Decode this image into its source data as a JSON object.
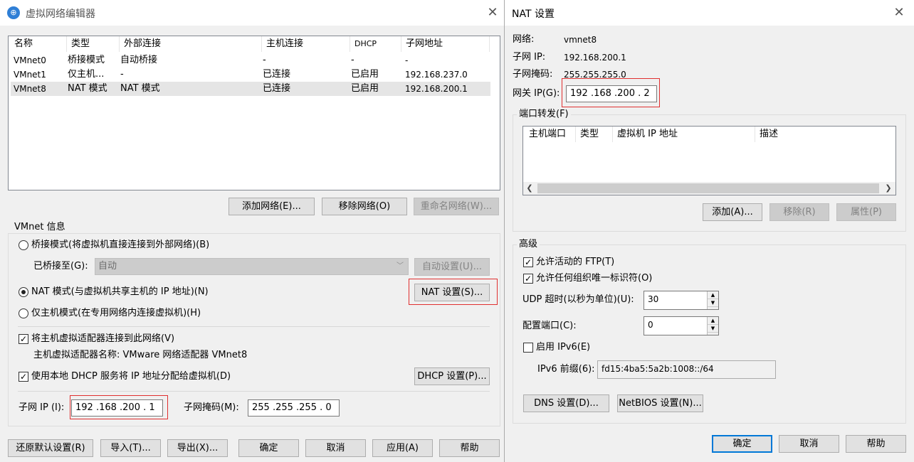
{
  "left": {
    "title": "虚拟网络编辑器",
    "table": {
      "headers": [
        "名称",
        "类型",
        "外部连接",
        "主机连接",
        "DHCP",
        "子网地址"
      ],
      "rows": [
        [
          "VMnet0",
          "桥接模式",
          "自动桥接",
          "-",
          "-",
          "-"
        ],
        [
          "VMnet1",
          "仅主机...",
          "-",
          "已连接",
          "已启用",
          "192.168.237.0"
        ],
        [
          "VMnet8",
          "NAT 模式",
          "NAT 模式",
          "已连接",
          "已启用",
          "192.168.200.1"
        ]
      ]
    },
    "add_network": "添加网络(E)...",
    "remove_network": "移除网络(O)",
    "rename_network": "重命名网络(W)...",
    "vmnet_info": "VMnet 信息",
    "bridged_mode": "桥接模式(将虚拟机直接连接到外部网络)(B)",
    "bridged_to_label": "已桥接至(G):",
    "bridged_to_value": "自动",
    "auto_settings": "自动设置(U)...",
    "nat_mode": "NAT 模式(与虚拟机共享主机的 IP 地址)(N)",
    "nat_settings": "NAT 设置(S)...",
    "host_only_mode": "仅主机模式(在专用网络内连接虚拟机)(H)",
    "connect_adapter": "将主机虚拟适配器连接到此网络(V)",
    "adapter_name": "主机虚拟适配器名称: VMware 网络适配器 VMnet8",
    "use_dhcp": "使用本地 DHCP 服务将 IP 地址分配给虚拟机(D)",
    "dhcp_settings": "DHCP 设置(P)...",
    "subnet_ip_label": "子网 IP (I):",
    "subnet_ip": "192 .168 .200 . 1",
    "subnet_mask_label": "子网掩码(M):",
    "subnet_mask": "255 .255 .255 . 0",
    "restore_defaults": "还原默认设置(R)",
    "import": "导入(T)...",
    "export": "导出(X)...",
    "ok": "确定",
    "cancel": "取消",
    "apply": "应用(A)",
    "help": "帮助"
  },
  "right": {
    "title": "NAT 设置",
    "network_label": "网络:",
    "network_value": "vmnet8",
    "subnet_ip_label": "子网 IP:",
    "subnet_ip_value": "192.168.200.1",
    "subnet_mask_label": "子网掩码:",
    "subnet_mask_value": "255.255.255.0",
    "gateway_label": "网关 IP(G):",
    "gateway_value": "192 .168 .200 . 2",
    "port_forwarding": "端口转发(F)",
    "pf_headers": [
      "主机端口",
      "类型",
      "虚拟机 IP 地址",
      "描述"
    ],
    "add": "添加(A)...",
    "remove": "移除(R)",
    "properties": "属性(P)",
    "advanced": "高级",
    "allow_ftp": "允许活动的 FTP(T)",
    "allow_oui": "允许任何组织唯一标识符(O)",
    "udp_timeout_label": "UDP 超时(以秒为单位)(U):",
    "udp_timeout_value": "30",
    "config_port_label": "配置端口(C):",
    "config_port_value": "0",
    "enable_ipv6": "启用 IPv6(E)",
    "ipv6_prefix_label": "IPv6 前缀(6):",
    "ipv6_prefix_value": "fd15:4ba5:5a2b:1008::/64",
    "dns_settings": "DNS 设置(D)...",
    "netbios_settings": "NetBIOS 设置(N)...",
    "ok": "确定",
    "cancel": "取消",
    "help": "帮助"
  }
}
